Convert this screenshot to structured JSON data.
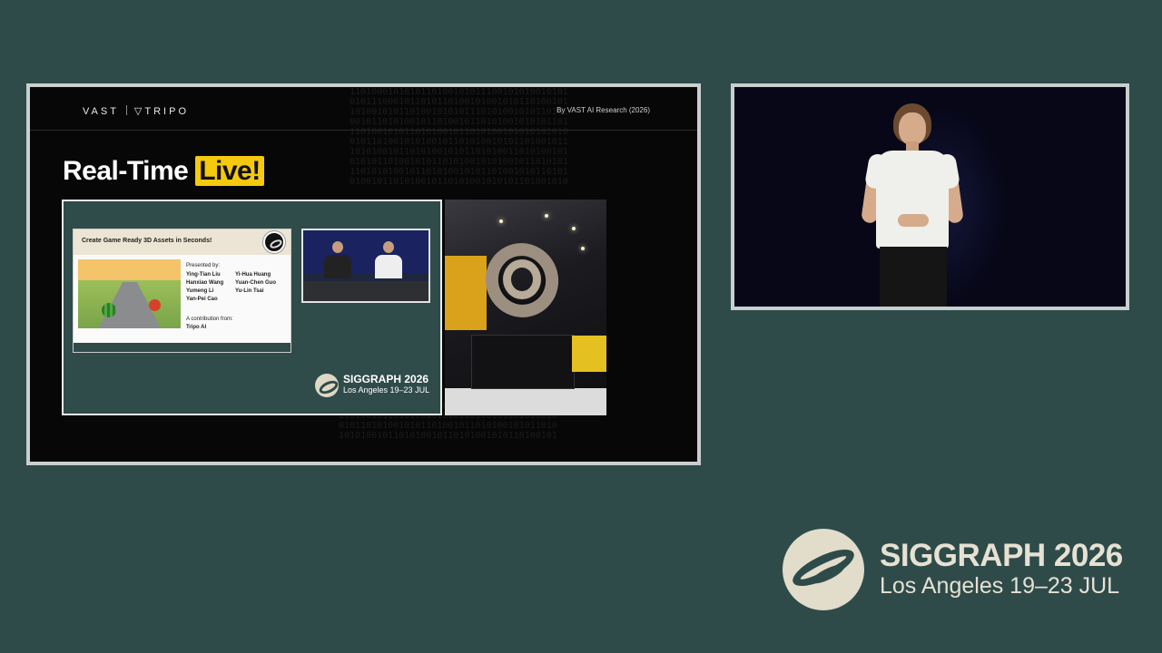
{
  "slide": {
    "brand_left": "VAST",
    "brand_right": "▽TRIPO",
    "byline": "By VAST AI Research  (2026)",
    "title_main": "Real-Time",
    "title_highlight": "Live!",
    "card": {
      "heading": "Create Game Ready 3D Assets in Seconds!",
      "presented_by_label": "Presented by:",
      "presenters_col1": [
        "Ying-Tian Liu",
        "Hanxiao Wang",
        "Yumeng Li",
        "Yan-Pei Cao"
      ],
      "presenters_col2": [
        "Yi-Hua Huang",
        "Yuan-Chen Guo",
        "Yu-Lin Tsai"
      ],
      "contribution_label": "A contribution from:",
      "contribution_org": "Tripo AI"
    },
    "mini_logo": {
      "name": "SIGGRAPH 2026",
      "place": "Los Angeles  19–23 JUL"
    }
  },
  "branding": {
    "name": "SIGGRAPH 2026",
    "place": "Los Angeles  19–23 JUL"
  },
  "colors": {
    "background": "#2e4b4a",
    "highlight": "#f5c90d",
    "logo_cream": "#e2dccb"
  },
  "icons": [
    "siggraph-logo-icon",
    "tripo-logo-icon"
  ]
}
